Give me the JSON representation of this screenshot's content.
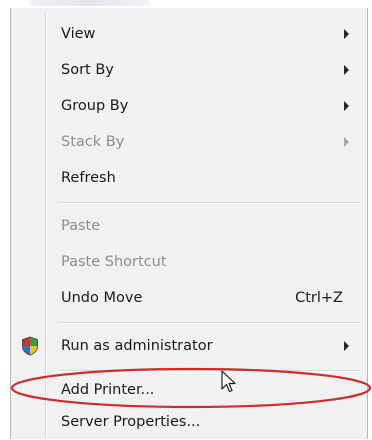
{
  "menu": {
    "items": [
      {
        "label": "View",
        "has_submenu": true,
        "disabled": false
      },
      {
        "label": "Sort By",
        "has_submenu": true,
        "disabled": false
      },
      {
        "label": "Group By",
        "has_submenu": true,
        "disabled": false
      },
      {
        "label": "Stack By",
        "has_submenu": true,
        "disabled": true
      },
      {
        "label": "Refresh",
        "has_submenu": false,
        "disabled": false
      },
      {
        "label": "Paste",
        "has_submenu": false,
        "disabled": true
      },
      {
        "label": "Paste Shortcut",
        "has_submenu": false,
        "disabled": true
      },
      {
        "label": "Undo Move",
        "accelerator": "Ctrl+Z",
        "has_submenu": false,
        "disabled": false
      },
      {
        "label": "Run as administrator",
        "icon": "uac-shield-icon",
        "has_submenu": true,
        "disabled": false
      },
      {
        "label": "Add Printer...",
        "has_submenu": false,
        "disabled": false,
        "circled": true
      },
      {
        "label": "Server Properties...",
        "has_submenu": false,
        "disabled": false
      }
    ]
  },
  "colors": {
    "menu_background": "#f1f1f1",
    "annotation_ellipse": "#d32a2a",
    "disabled_text": "#8e8e8e",
    "shield_red": "#c8362b",
    "shield_green": "#3e9a3a",
    "shield_blue": "#2e6fc7",
    "shield_yellow": "#f2c12e"
  }
}
